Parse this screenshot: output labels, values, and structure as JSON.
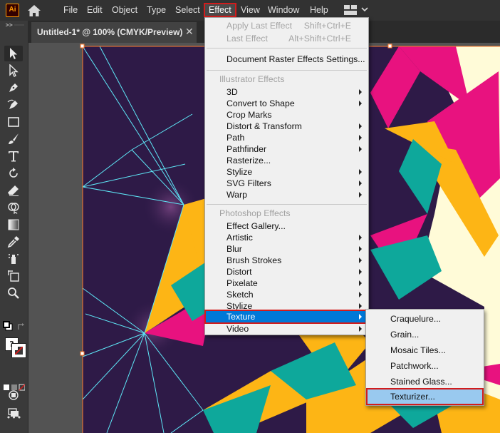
{
  "app": {
    "logo_text": "Ai"
  },
  "menubar": {
    "items": [
      {
        "label": "File"
      },
      {
        "label": "Edit"
      },
      {
        "label": "Object"
      },
      {
        "label": "Type"
      },
      {
        "label": "Select"
      },
      {
        "label": "Effect"
      },
      {
        "label": "View"
      },
      {
        "label": "Window"
      },
      {
        "label": "Help"
      }
    ],
    "active": "Effect"
  },
  "document": {
    "tab_title": "Untitled-1* @ 100% (CMYK/Preview)",
    "close_glyph": "✕"
  },
  "toolbar": {
    "tools": [
      "selection-tool",
      "direct-selection-tool",
      "pen-tool",
      "curvature-tool",
      "rectangle-tool",
      "paintbrush-tool",
      "type-tool",
      "rotate-tool",
      "eraser-tool",
      "shape-builder-tool",
      "gradient-tool",
      "eyedropper-tool",
      "symbol-sprayer-tool",
      "artboard-tool",
      "zoom-tool",
      "fill-stroke-swap",
      "fill-stroke-swatch",
      "drawing-modes",
      "screen-mode",
      "more-tools"
    ],
    "swatch_glyph": "?",
    "more_glyph": "•••"
  },
  "effect_menu": {
    "apply_last": {
      "label": "Apply Last Effect",
      "shortcut": "Shift+Ctrl+E"
    },
    "last": {
      "label": "Last Effect",
      "shortcut": "Alt+Shift+Ctrl+E"
    },
    "raster_settings": "Document Raster Effects Settings...",
    "illustrator_header": "Illustrator Effects",
    "illustrator_items": [
      {
        "label": "3D",
        "submenu": true
      },
      {
        "label": "Convert to Shape",
        "submenu": true
      },
      {
        "label": "Crop Marks",
        "submenu": false
      },
      {
        "label": "Distort & Transform",
        "submenu": true
      },
      {
        "label": "Path",
        "submenu": true
      },
      {
        "label": "Pathfinder",
        "submenu": true
      },
      {
        "label": "Rasterize...",
        "submenu": false
      },
      {
        "label": "Stylize",
        "submenu": true
      },
      {
        "label": "SVG Filters",
        "submenu": true
      },
      {
        "label": "Warp",
        "submenu": true
      }
    ],
    "photoshop_header": "Photoshop Effects",
    "photoshop_items": [
      {
        "label": "Effect Gallery...",
        "submenu": false
      },
      {
        "label": "Artistic",
        "submenu": true
      },
      {
        "label": "Blur",
        "submenu": true
      },
      {
        "label": "Brush Strokes",
        "submenu": true
      },
      {
        "label": "Distort",
        "submenu": true
      },
      {
        "label": "Pixelate",
        "submenu": true
      },
      {
        "label": "Sketch",
        "submenu": true
      },
      {
        "label": "Stylize",
        "submenu": true
      },
      {
        "label": "Texture",
        "submenu": true
      },
      {
        "label": "Video",
        "submenu": true
      }
    ],
    "highlighted": "Texture"
  },
  "texture_submenu": {
    "items": [
      "Craquelure...",
      "Grain...",
      "Mosaic Tiles...",
      "Patchwork...",
      "Stained Glass...",
      "Texturizer..."
    ],
    "highlighted": "Texturizer..."
  },
  "colors": {
    "accent_highlight": "#0078d7",
    "submenu_highlight": "#99c9ef",
    "callout_red": "#d21c1c",
    "art_background": "#2e1a47",
    "art_pink": "#e8127f",
    "art_orange": "#fdb515",
    "art_teal": "#0ea89b",
    "art_cream": "#fffbd8",
    "art_lines": "#5ee8f8"
  }
}
